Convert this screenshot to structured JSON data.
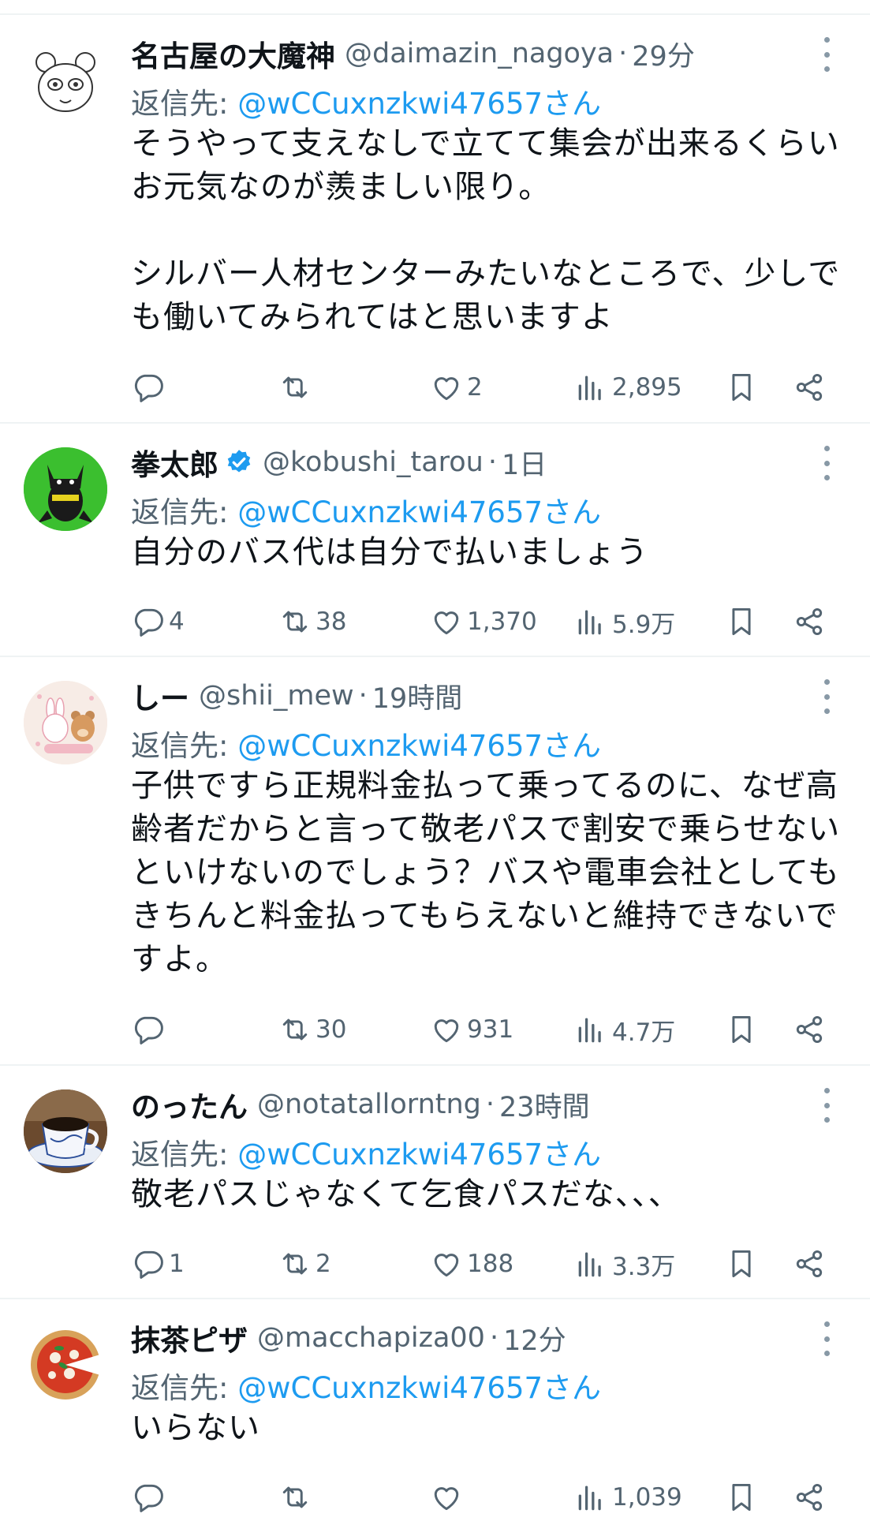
{
  "replies": [
    {
      "name": "名古屋の大魔神",
      "handle": "@daimazin_nagoya",
      "time": "29分",
      "reply_label": "返信先: ",
      "reply_to": "@wCCuxnzkwi47657さん",
      "text": "そうやって支えなしで立てて集会が出来るくらいお元気なのが羨ましい限り。\n\nシルバー人材センターみたいなところで、少しでも働いてみられてはと思いますよ",
      "replies": "",
      "retweets": "",
      "likes": "2",
      "views": "2,895",
      "avatar_icon": "panda-sketch-avatar"
    },
    {
      "name": "拳太郎",
      "handle": "@kobushi_tarou",
      "time": "1日",
      "reply_label": "返信先: ",
      "reply_to": "@wCCuxnzkwi47657さん",
      "text": "自分のバス代は自分で払いましょう",
      "replies": "4",
      "retweets": "38",
      "likes": "1,370",
      "views": "5.9万",
      "avatar_icon": "black-cat-avatar"
    },
    {
      "name": "しー",
      "handle": "@shii_mew",
      "time": "19時間",
      "reply_label": "返信先: ",
      "reply_to": "@wCCuxnzkwi47657さん",
      "text": "子供ですら正規料金払って乗ってるのに、なぜ高齢者だからと言って敬老パスで割安で乗らせないといけないのでしょう？バスや電車会社としてもきちんと料金払ってもらえないと維持できないですよ。",
      "replies": "",
      "retweets": "30",
      "likes": "931",
      "views": "4.7万",
      "avatar_icon": "bunny-bear-avatar"
    },
    {
      "name": "のったん",
      "handle": "@notatallorntng",
      "time": "23時間",
      "reply_label": "返信先: ",
      "reply_to": "@wCCuxnzkwi47657さん",
      "text": "敬老パスじゃなくて乞食パスだな、、、",
      "replies": "1",
      "retweets": "2",
      "likes": "188",
      "views": "3.3万",
      "avatar_icon": "coffee-cup-avatar"
    },
    {
      "name": "抹茶ピザ",
      "handle": "@macchapiza00",
      "time": "12分",
      "reply_label": "返信先: ",
      "reply_to": "@wCCuxnzkwi47657さん",
      "text": "いらない",
      "replies": "",
      "retweets": "",
      "likes": "",
      "views": "1,039",
      "avatar_icon": "pizza-avatar"
    }
  ],
  "colors": {
    "accent": "#1d9bf0",
    "muted": "#536471",
    "divider": "#eff3f4",
    "text": "#0f1419"
  }
}
